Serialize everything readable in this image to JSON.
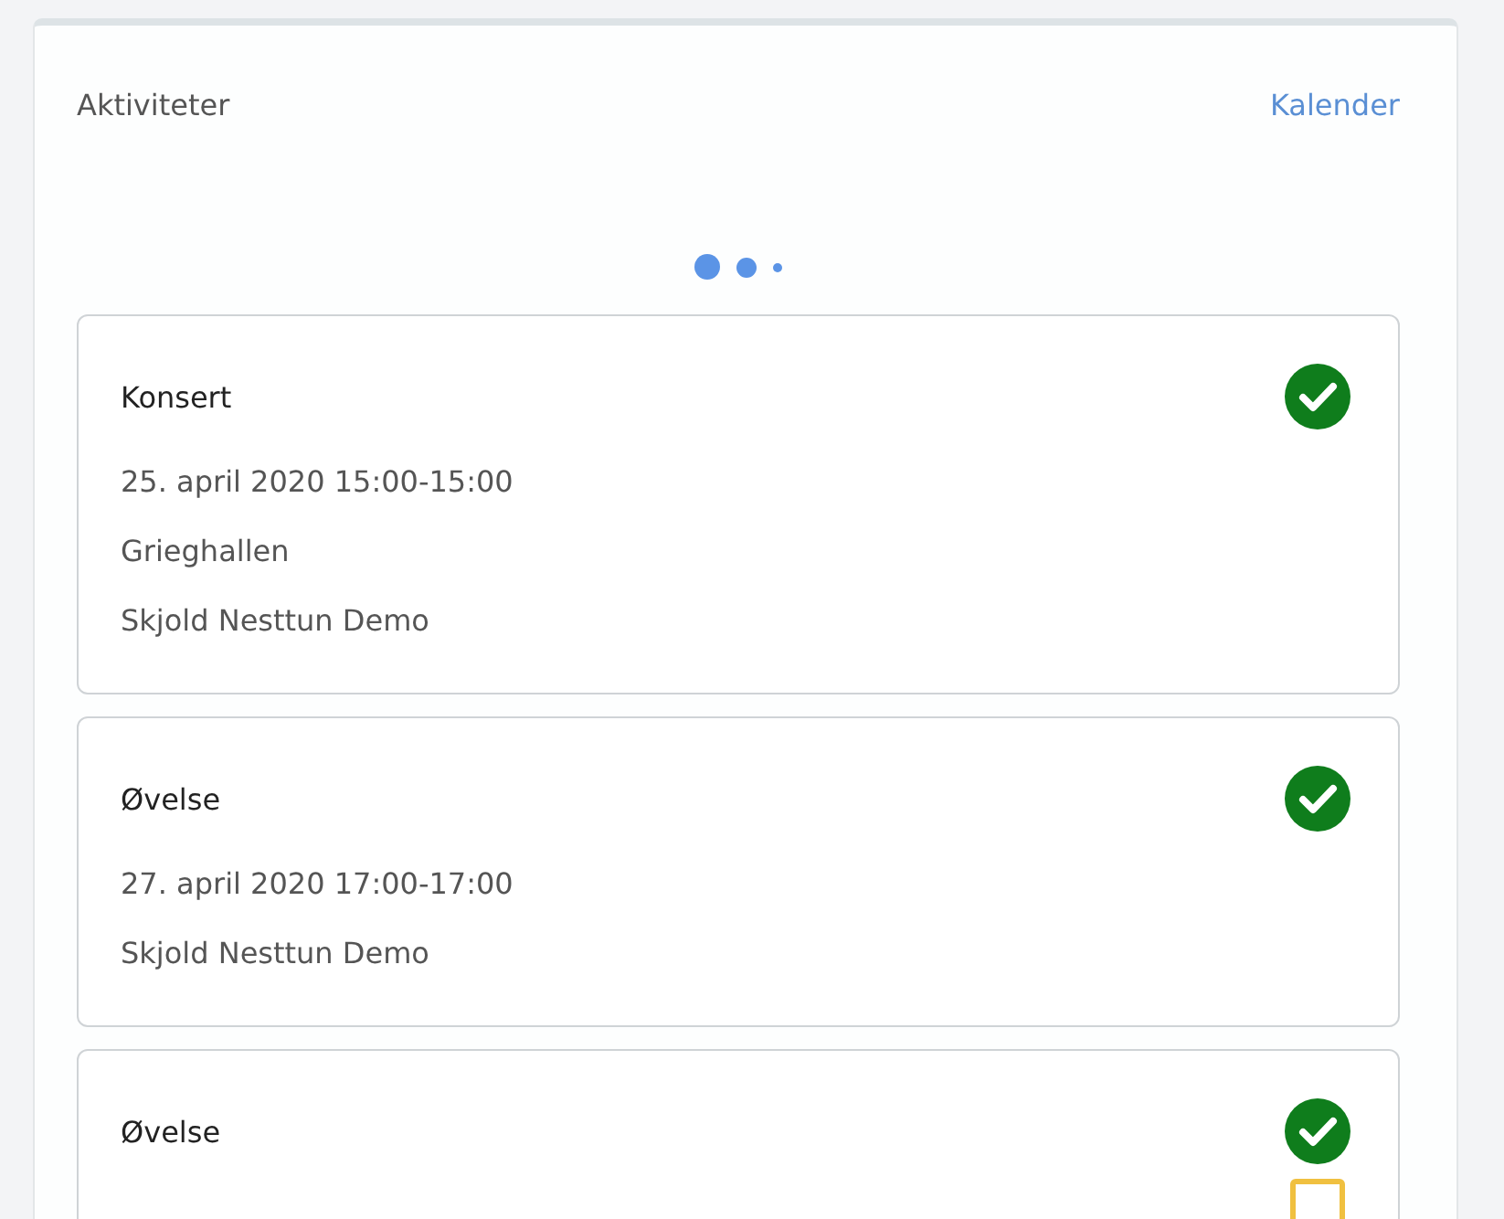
{
  "panel": {
    "title": "Aktiviteter",
    "link": "Kalender"
  },
  "pager": [
    {
      "kind": "large"
    },
    {
      "kind": "medium"
    },
    {
      "kind": "small"
    }
  ],
  "activities": [
    {
      "title": "Konsert",
      "lines": [
        "25. april 2020 15:00-15:00",
        "Grieghallen",
        "Skjold Nesttun Demo"
      ],
      "confirmed": true,
      "pending": false
    },
    {
      "title": "Øvelse",
      "lines": [
        "27. april 2020 17:00-17:00",
        "Skjold Nesttun Demo"
      ],
      "confirmed": true,
      "pending": false
    },
    {
      "title": "Øvelse",
      "confirmed": true,
      "pending": true
    }
  ]
}
